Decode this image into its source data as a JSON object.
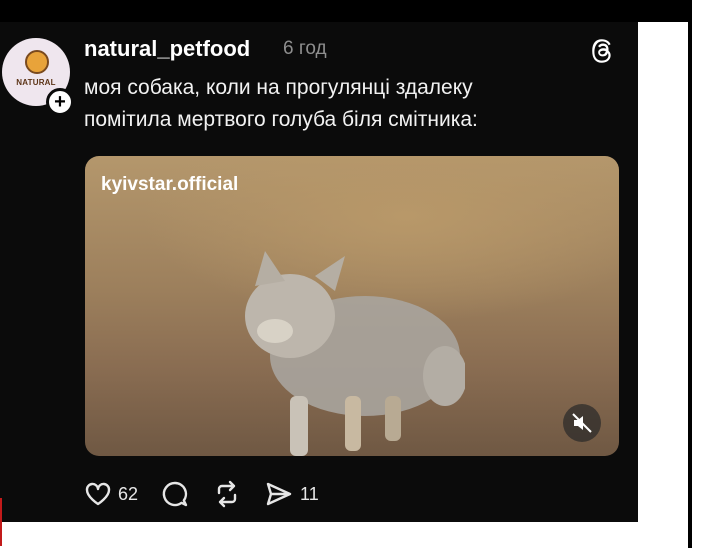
{
  "post": {
    "username": "natural_petfood",
    "time": "6 год",
    "avatar_text": "NATURAL",
    "follow_symbol": "+",
    "caption_line1": "моя собака, коли на прогулянці здалеку",
    "caption_line2": "помітила мертвого голуба біля смітника:",
    "media": {
      "watermark": "kyivstar.official"
    }
  },
  "actions": {
    "likes": "62",
    "reposts_send": "11"
  },
  "icons": {
    "threads": "threads-logo-icon",
    "like": "heart-icon",
    "comment": "comment-bubble-icon",
    "repost": "repost-icon",
    "share": "send-icon",
    "mute": "muted-speaker-icon"
  },
  "colors": {
    "background": "#0b0b0b",
    "text": "#ffffff",
    "muted_text": "#8e8e8e"
  }
}
